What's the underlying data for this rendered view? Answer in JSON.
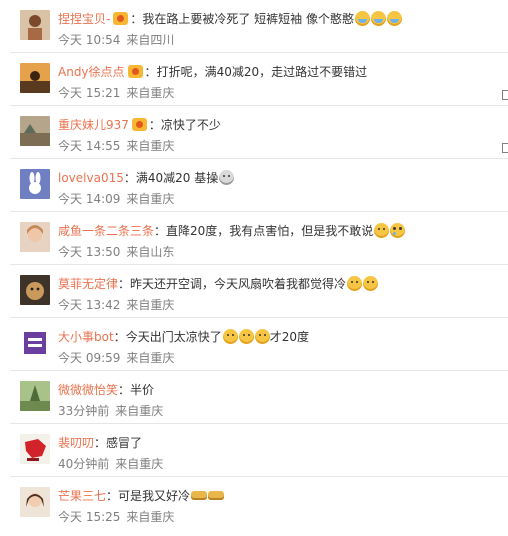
{
  "comments": [
    {
      "name": "捏捏宝贝-",
      "badge": true,
      "text": "我在路上要被冷死了 短裤短袖 像个憨憨",
      "emojis": [
        "blue",
        "blue",
        "blue"
      ],
      "time": "今天 10:54",
      "source": "来自四川",
      "reply": false
    },
    {
      "name": "Andy徐点点",
      "badge": true,
      "text": "打折呢，满40减20，走过路过不要错过",
      "emojis": [],
      "time": "今天 15:21",
      "source": "来自重庆",
      "reply": true
    },
    {
      "name": "重庆妹儿937",
      "badge": true,
      "text": "凉快了不少",
      "emojis": [],
      "time": "今天 14:55",
      "source": "来自重庆",
      "reply": true
    },
    {
      "name": "lovelva015",
      "badge": false,
      "text": "满40减20 基操",
      "emojis": [
        "gray"
      ],
      "time": "今天 14:09",
      "source": "来自重庆",
      "reply": false
    },
    {
      "name": "咸鱼一条二条三条",
      "badge": false,
      "text": "直降20度，我有点害怕，但是我不敢说",
      "emojis": [
        "face",
        "cry"
      ],
      "time": "今天 13:50",
      "source": "来自山东",
      "reply": false
    },
    {
      "name": "莫菲无定律",
      "badge": false,
      "text": "昨天还开空调，今天风扇吹着我都觉得冷",
      "emojis": [
        "face",
        "face"
      ],
      "time": "今天 13:42",
      "source": "来自重庆",
      "reply": false
    },
    {
      "name": "大小事bot",
      "badge": false,
      "text": "今天出门太凉快了",
      "emojis": [
        "face",
        "face",
        "face"
      ],
      "text_after": "才20度",
      "time": "今天 09:59",
      "source": "来自重庆",
      "reply": false
    },
    {
      "name": "微微微怡笑",
      "badge": false,
      "text": "半价",
      "emojis": [],
      "time": "33分钟前",
      "source": "来自重庆",
      "reply": false
    },
    {
      "name": "裴叨叨",
      "badge": false,
      "text": "感冒了",
      "emojis": [],
      "time": "40分钟前",
      "source": "来自重庆",
      "reply": false
    },
    {
      "name": "芒果三七",
      "badge": false,
      "text": "可是我又好冷",
      "emojis": [
        "slap",
        "slap"
      ],
      "time": "今天 15:25",
      "source": "来自重庆",
      "reply": false
    }
  ],
  "colors": {
    "name": "#eb7350",
    "meta": "#808080",
    "text": "#333333",
    "divider": "#e6e6e6"
  }
}
